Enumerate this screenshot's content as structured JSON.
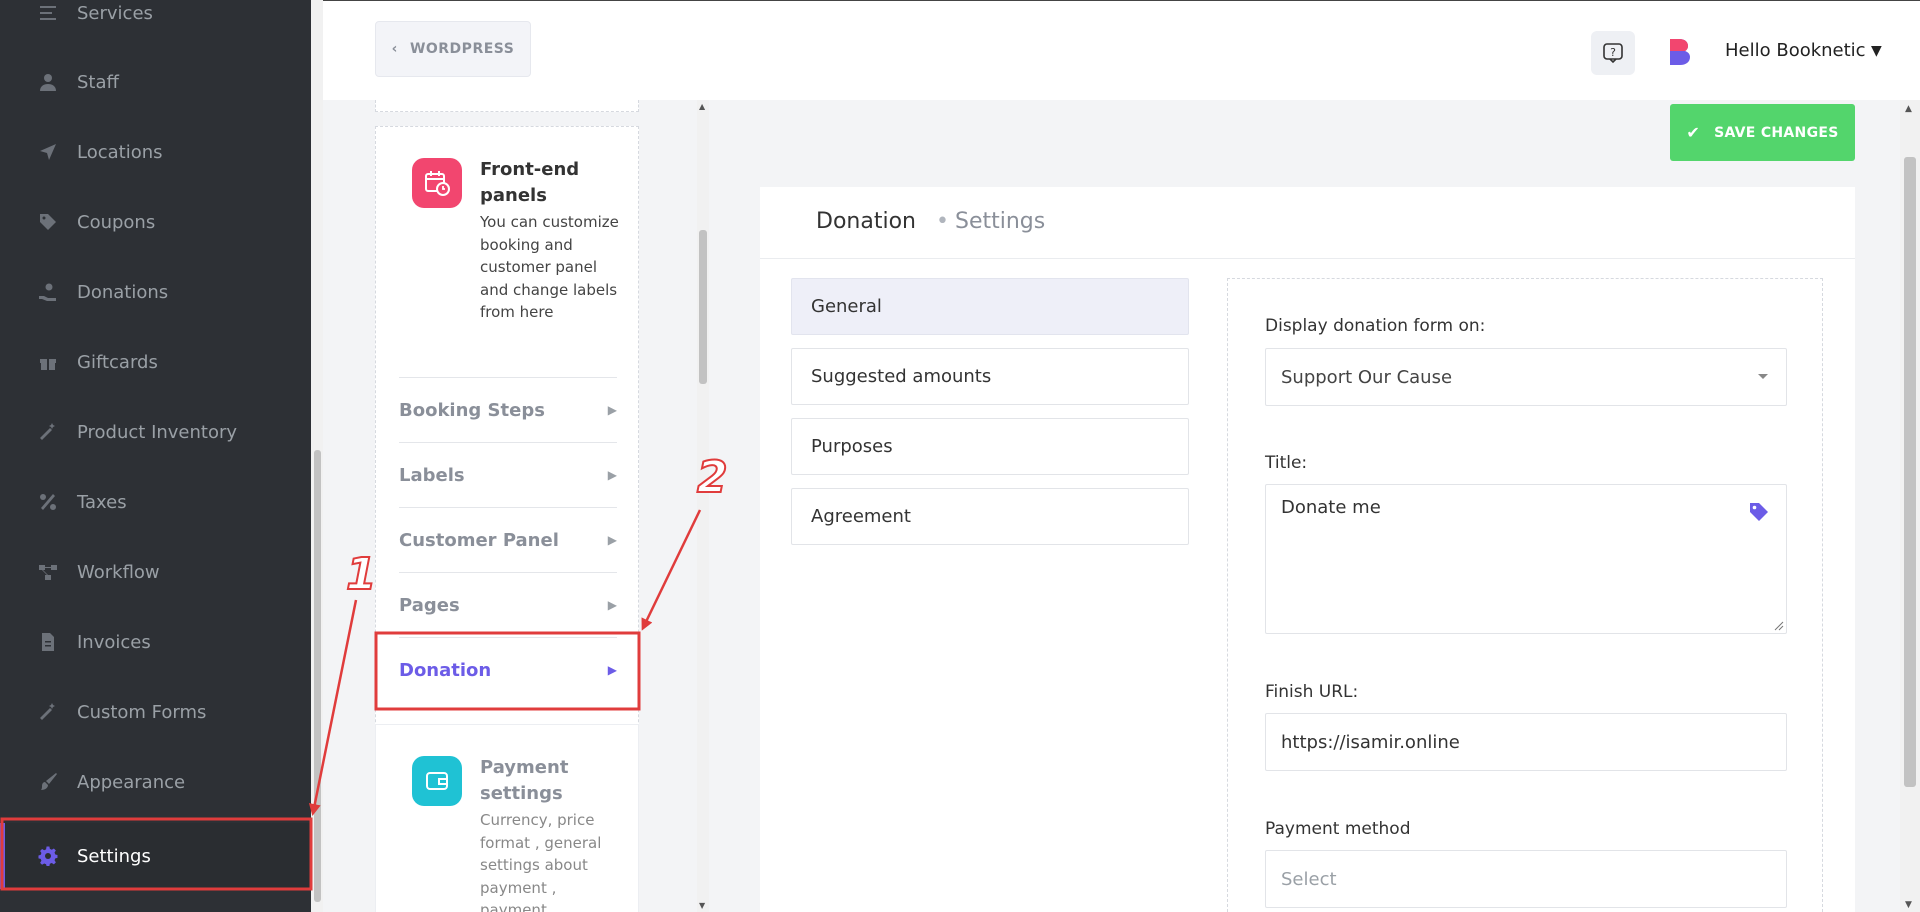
{
  "sidebar": {
    "items": [
      {
        "label": "Services",
        "icon": "list-icon"
      },
      {
        "label": "Staff",
        "icon": "user-icon"
      },
      {
        "label": "Locations",
        "icon": "location-arrow-icon"
      },
      {
        "label": "Coupons",
        "icon": "tag-icon"
      },
      {
        "label": "Donations",
        "icon": "hand-holding-icon"
      },
      {
        "label": "Giftcards",
        "icon": "gift-icon"
      },
      {
        "label": "Product Inventory",
        "icon": "magic-wand-icon"
      },
      {
        "label": "Taxes",
        "icon": "percent-icon"
      },
      {
        "label": "Workflow",
        "icon": "workflow-icon"
      },
      {
        "label": "Invoices",
        "icon": "file-icon"
      },
      {
        "label": "Custom Forms",
        "icon": "magic-wand-icon"
      },
      {
        "label": "Appearance",
        "icon": "brush-icon"
      },
      {
        "label": "Settings",
        "icon": "gear-icon",
        "active": true
      }
    ]
  },
  "header": {
    "wordpress_label": "WORDPRESS",
    "user_greeting": "Hello Booknetic"
  },
  "settings_nav": {
    "frontend": {
      "title": "Front-end panels",
      "description": "You can customize booking and customer panel and change labels from here",
      "items": [
        {
          "label": "Booking Steps"
        },
        {
          "label": "Labels"
        },
        {
          "label": "Customer Panel"
        },
        {
          "label": "Pages"
        },
        {
          "label": "Donation",
          "active": true
        }
      ]
    },
    "payment": {
      "title": "Payment settings",
      "description": "Currency, price format , general settings about payment , payment"
    }
  },
  "toolbar": {
    "save_label": "SAVE CHANGES"
  },
  "main": {
    "breadcrumb_main": "Donation",
    "breadcrumb_sub": "Settings",
    "tabs": [
      {
        "label": "General",
        "active": true
      },
      {
        "label": "Suggested amounts"
      },
      {
        "label": "Purposes"
      },
      {
        "label": "Agreement"
      }
    ],
    "form": {
      "display_label": "Display donation form on:",
      "display_value": "Support Our Cause",
      "title_label": "Title:",
      "title_value": "Donate me",
      "finish_url_label": "Finish URL:",
      "finish_url_value": "https://isamir.online",
      "payment_method_label": "Payment method",
      "payment_method_placeholder": "Select"
    }
  },
  "annotations": {
    "step1": "1",
    "step2": "2"
  },
  "colors": {
    "accent": "#6c5ce7",
    "save": "#53d56c",
    "annotation": "#e03c3c",
    "frontend_icon": "#f2466f",
    "payment_icon": "#1fc2d4"
  }
}
